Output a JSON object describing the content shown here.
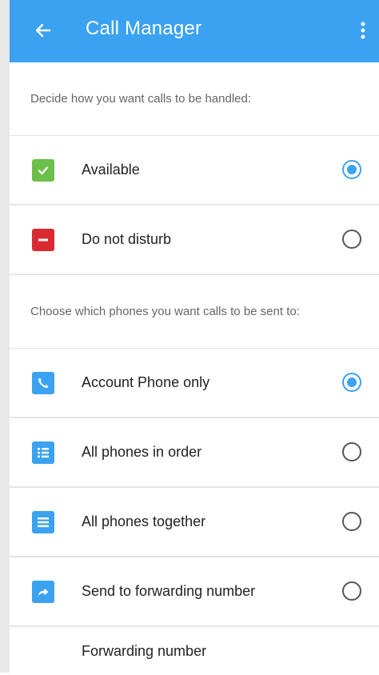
{
  "appbar": {
    "title": "Call Manager",
    "back_icon": "arrow-left-icon",
    "menu_icon": "more-vertical-icon",
    "color": "#3aa2f0"
  },
  "sections": {
    "handling": {
      "header": "Decide how you want calls to be handled:",
      "options": [
        {
          "label": "Available",
          "icon": "check-icon",
          "icon_color": "#6cc04a",
          "selected": true
        },
        {
          "label": "Do not disturb",
          "icon": "minus-icon",
          "icon_color": "#d92a32",
          "selected": false
        }
      ]
    },
    "routing": {
      "header": "Choose which phones you want calls to be sent to:",
      "options": [
        {
          "label": "Account Phone only",
          "icon": "phone-icon",
          "icon_color": "#3aa2f0",
          "selected": true
        },
        {
          "label": "All phones in order",
          "icon": "ordered-list-icon",
          "icon_color": "#3aa2f0",
          "selected": false
        },
        {
          "label": "All phones together",
          "icon": "list-icon",
          "icon_color": "#3aa2f0",
          "selected": false
        },
        {
          "label": "Send to forwarding number",
          "icon": "forward-arrow-icon",
          "icon_color": "#3aa2f0",
          "selected": false
        }
      ]
    },
    "forwarding": {
      "label": "Forwarding number"
    }
  }
}
